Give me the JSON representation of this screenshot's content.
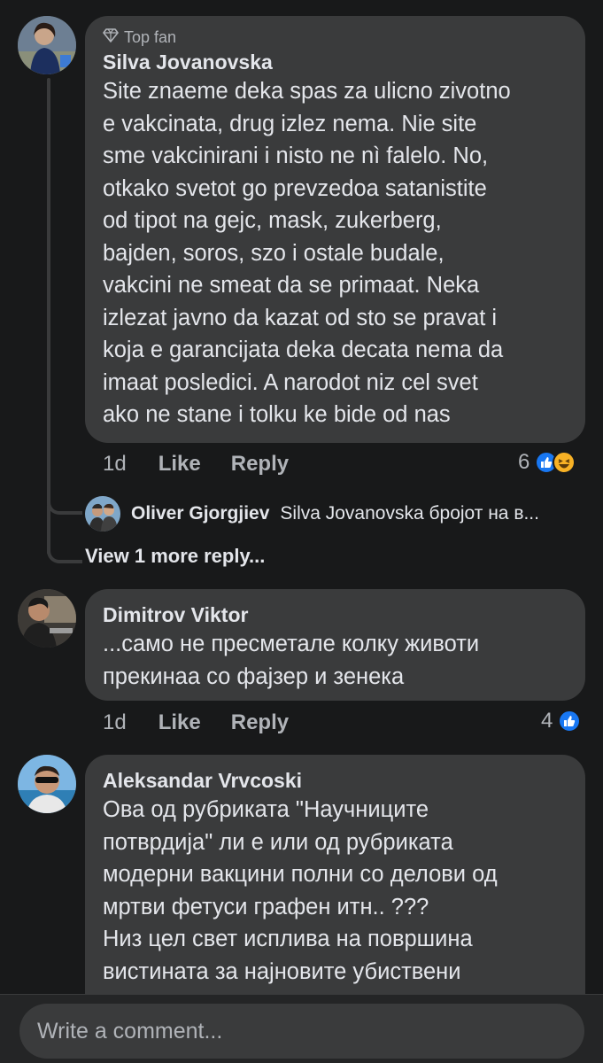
{
  "comments": [
    {
      "badge": "Top fan",
      "author": "Silva Jovanovska",
      "lines": [
        "Site znaeme deka spas za ulicno zivotno",
        "e vakcinata, drug izlez nema. Nie site",
        "sme vakcinirani i nisto ne nì falelo. No,",
        "otkako svetot go prevzedoa satanistite",
        "od tipot na gejc, mask, zukerberg,",
        "bajden, soros, szo i ostale budale,",
        "vakcini ne smeat da se primaat. Neka",
        "izlezat javno da kazat od sto se pravat i",
        "koja e garancijata deka decata nema da",
        "imaat posledici. A narodot niz cel svet",
        "ako ne stane i tolku ke bide od nas"
      ],
      "time": "1d",
      "like_label": "Like",
      "reply_label": "Reply",
      "reaction_count": "6",
      "reactions": [
        "like",
        "haha"
      ]
    },
    {
      "author": "Dimitrov Viktor",
      "lines": [
        "...само не пресметале колку животи",
        "прекинаа со фајзер и зенека"
      ],
      "time": "1d",
      "like_label": "Like",
      "reply_label": "Reply",
      "reaction_count": "4",
      "reactions": [
        "like"
      ]
    },
    {
      "author": "Aleksandar Vrvcoski",
      "lines": [
        "Ова од рубриката \"Научниците",
        "потврдија\" ли е или од рубриката",
        "модерни вакцини полни со делови од",
        "мртви фетуси графен итн.. ???",
        "Низ цел свет исплива на површина",
        "вистината за најновите убиствени"
      ]
    }
  ],
  "reply_preview": {
    "author": "Oliver Gjorgjiev",
    "text": "Silva Jovanovska бројот на в..."
  },
  "more_replies_label": "View 1 more reply...",
  "composer": {
    "placeholder": "Write a comment..."
  },
  "colors": {
    "background": "#18191a",
    "bubble": "#3a3b3c",
    "like_blue": "#1877f2",
    "haha_yellow": "#f7b125",
    "secondary_text": "#b0b3b8"
  }
}
